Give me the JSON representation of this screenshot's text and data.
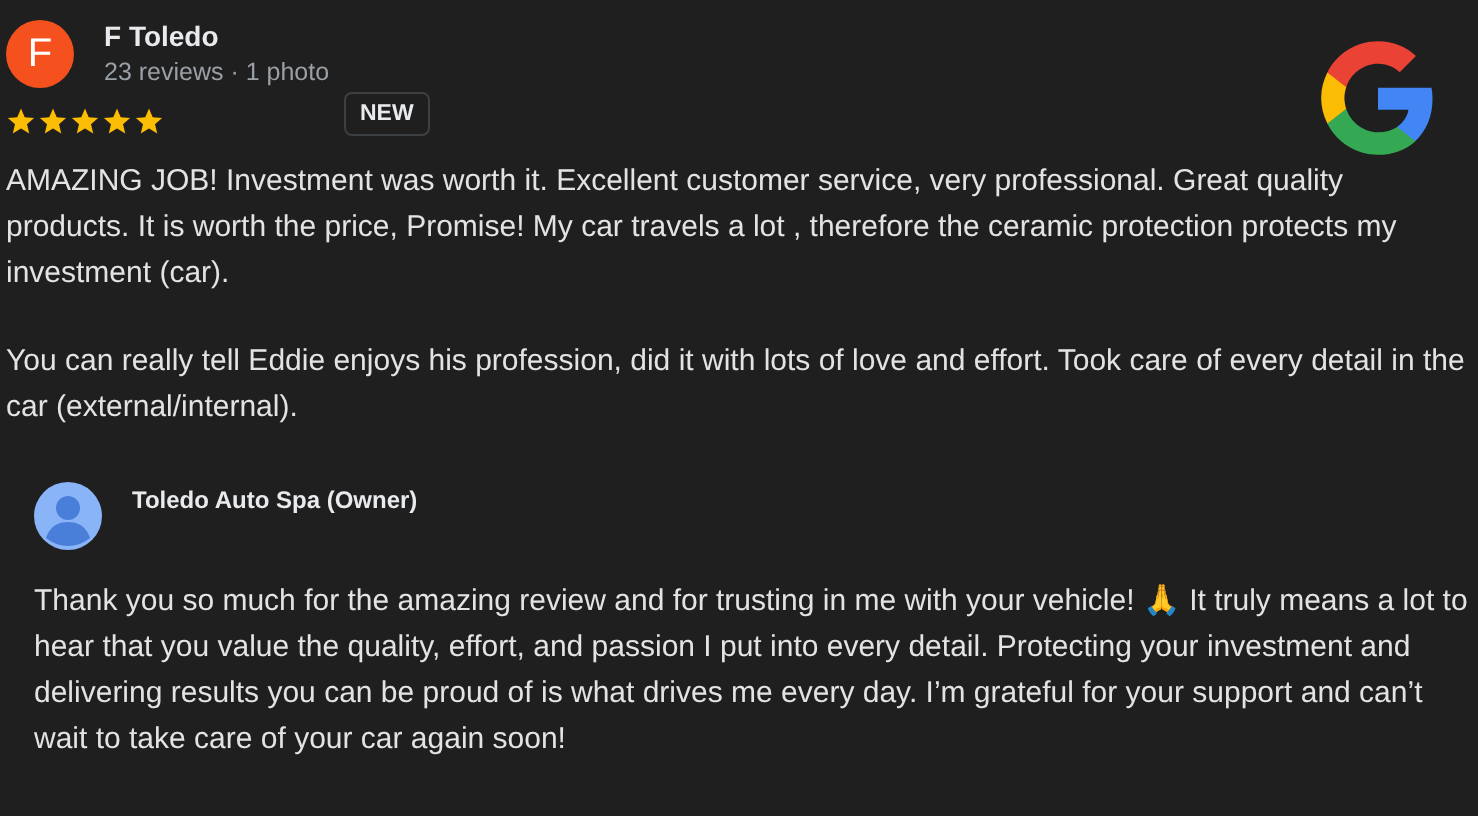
{
  "review": {
    "avatar_letter": "F",
    "author": "F Toledo",
    "meta": "23 reviews · 1 photo",
    "stars": 5,
    "badge": "NEW",
    "paragraphs": [
      "AMAZING JOB! Investment was worth it. Excellent customer service, very professional. Great quality products. It is worth the price, Promise! My car travels a lot , therefore the ceramic protection protects my investment (car).",
      "You can really tell Eddie enjoys his profession, did it with lots of love and effort. Took care of every detail in the car (external/internal)."
    ]
  },
  "reply": {
    "author": "Toledo Auto Spa (Owner)",
    "text": "Thank you so much for the amazing review and for trusting in me with your vehicle! 🙏 It truly means a lot to hear that you value the quality, effort, and passion I put into every detail. Protecting your investment and delivering results you can be proud of is what drives me every day. I’m grateful for your support and can’t wait to take care of your car again soon!"
  }
}
